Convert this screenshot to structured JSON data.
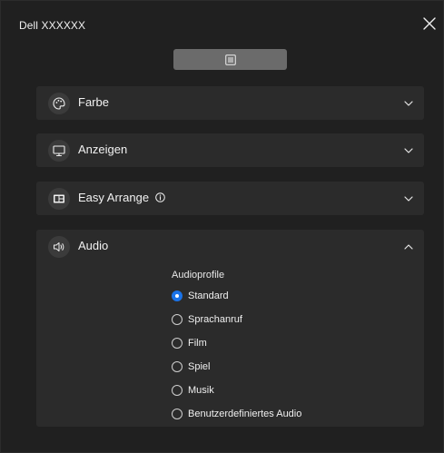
{
  "window": {
    "title": "Dell XXXXXX"
  },
  "sections": [
    {
      "id": "color",
      "label": "Farbe",
      "icon": "palette-icon",
      "expanded": false
    },
    {
      "id": "display",
      "label": "Anzeigen",
      "icon": "monitor-icon",
      "expanded": false
    },
    {
      "id": "easy_arrange",
      "label": "Easy Arrange",
      "icon": "layout-icon",
      "expanded": false,
      "has_info": true
    },
    {
      "id": "audio",
      "label": "Audio",
      "icon": "speaker-icon",
      "expanded": true
    }
  ],
  "audio": {
    "group_title": "Audioprofile",
    "options": [
      {
        "label": "Standard",
        "selected": true
      },
      {
        "label": "Sprachanruf",
        "selected": false
      },
      {
        "label": "Film",
        "selected": false
      },
      {
        "label": "Spiel",
        "selected": false
      },
      {
        "label": "Musik",
        "selected": false
      },
      {
        "label": "Benutzerdefiniertes Audio",
        "selected": false
      }
    ]
  },
  "colors": {
    "background": "#202020",
    "panel": "#2b2b2b",
    "toolbar_button": "#6b6b6b",
    "accent": "#1a73e8",
    "text": "#f2f2f2"
  }
}
